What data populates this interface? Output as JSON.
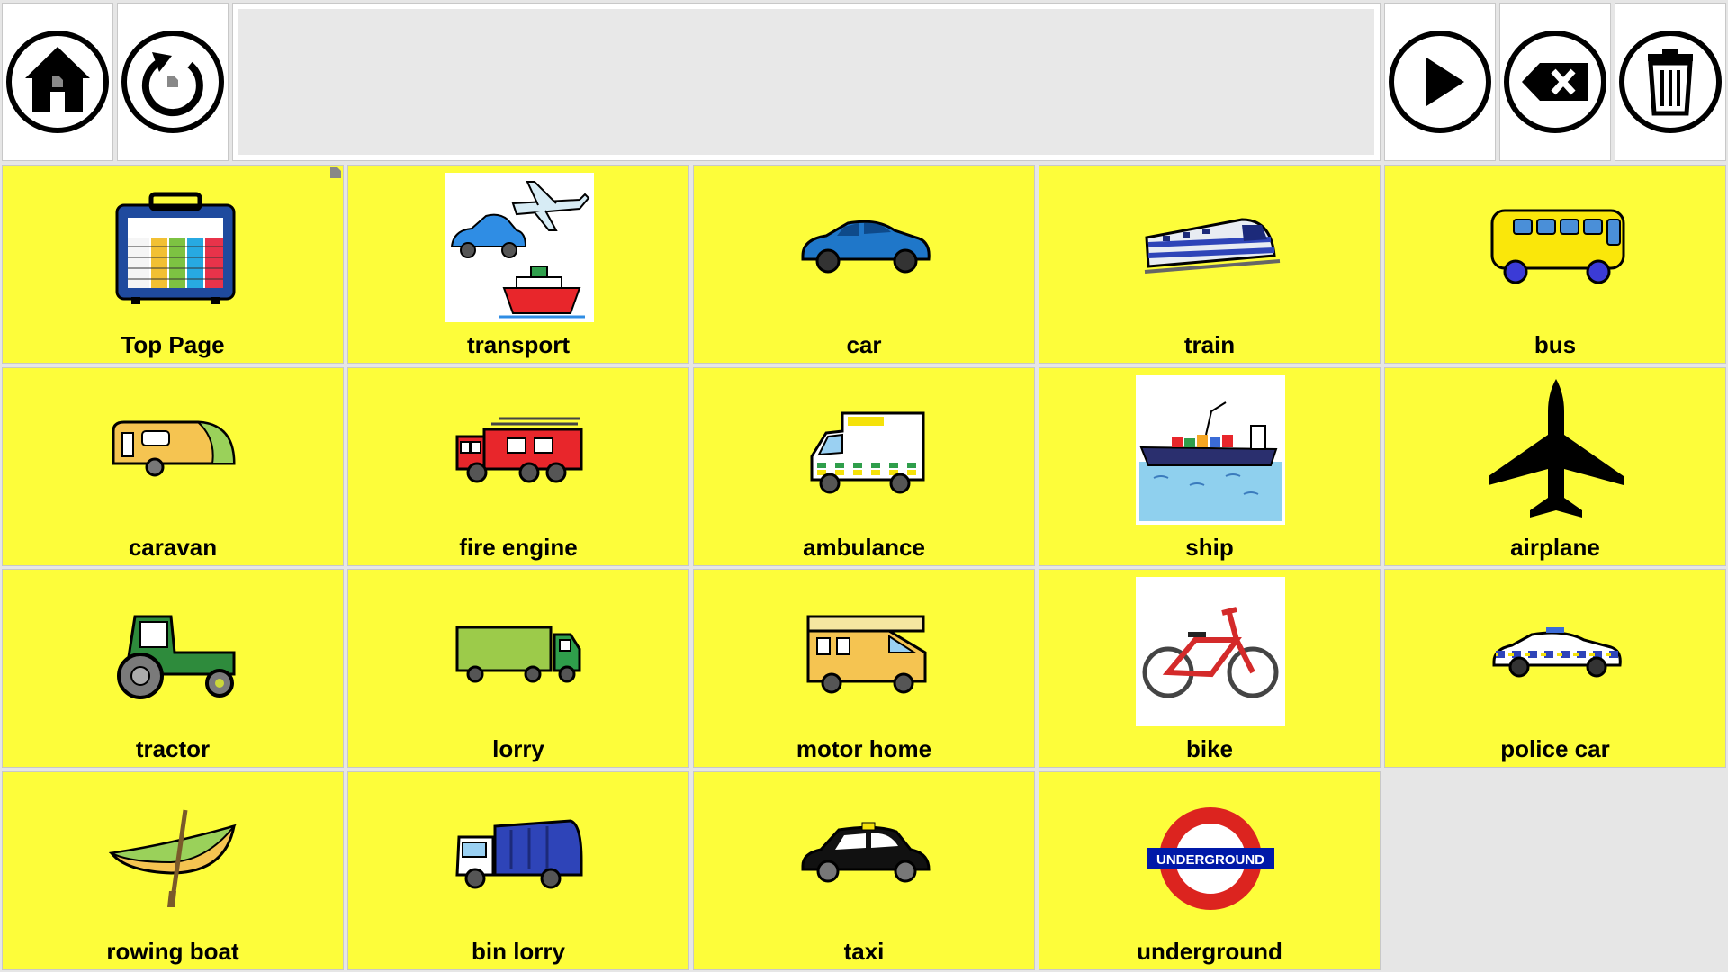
{
  "toolbar": {
    "home_icon": "home-icon",
    "undo_icon": "undo-icon",
    "play_icon": "play-icon",
    "backspace_icon": "backspace-icon",
    "clear_icon": "trash-icon"
  },
  "message_bar": {
    "text": ""
  },
  "colors": {
    "cell_background": "#fdfd3a",
    "page_background": "#e6e6e6"
  },
  "cells": [
    {
      "label": "Top Page",
      "icon": "board-icon"
    },
    {
      "label": "transport",
      "icon": "transport-icon"
    },
    {
      "label": "car",
      "icon": "car-icon"
    },
    {
      "label": "train",
      "icon": "train-icon"
    },
    {
      "label": "bus",
      "icon": "bus-icon"
    },
    {
      "label": "caravan",
      "icon": "caravan-icon"
    },
    {
      "label": "fire engine",
      "icon": "fire-engine-icon"
    },
    {
      "label": "ambulance",
      "icon": "ambulance-icon"
    },
    {
      "label": "ship",
      "icon": "ship-icon"
    },
    {
      "label": "airplane",
      "icon": "airplane-icon"
    },
    {
      "label": "tractor",
      "icon": "tractor-icon"
    },
    {
      "label": "lorry",
      "icon": "lorry-icon"
    },
    {
      "label": "motor home",
      "icon": "motor-home-icon"
    },
    {
      "label": "bike",
      "icon": "bike-icon"
    },
    {
      "label": "police car",
      "icon": "police-car-icon"
    },
    {
      "label": "rowing boat",
      "icon": "rowing-boat-icon"
    },
    {
      "label": "bin lorry",
      "icon": "bin-lorry-icon"
    },
    {
      "label": "taxi",
      "icon": "taxi-icon"
    },
    {
      "label": "underground",
      "icon": "underground-icon",
      "logo_text": "UNDERGROUND"
    }
  ]
}
